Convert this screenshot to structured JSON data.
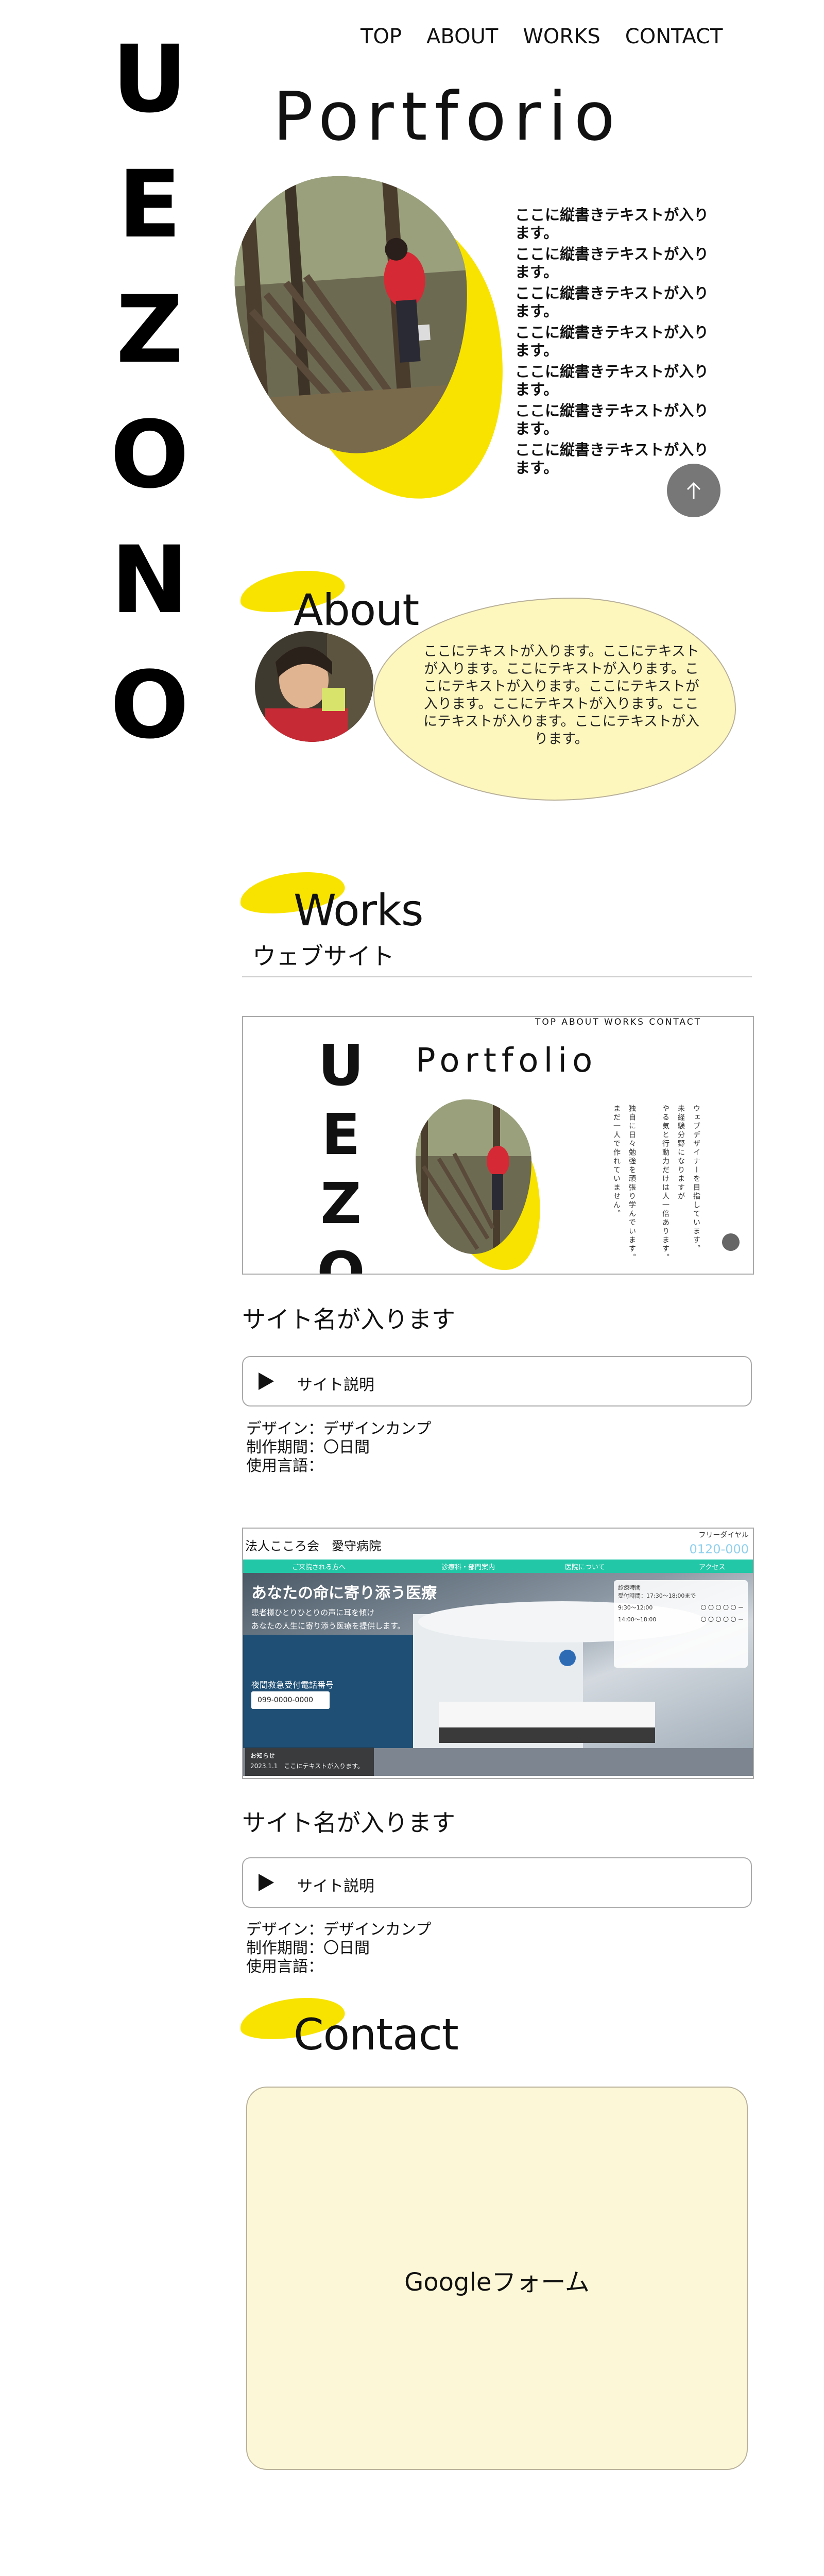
{
  "nav": {
    "items": [
      "TOP",
      "ABOUT",
      "WORKS",
      "CONTACT"
    ]
  },
  "brand": "UEZONO",
  "hero": {
    "title": "Portforio",
    "vertical_text": [
      "ここに縦書きテキストが入ります。",
      "ここに縦書きテキストが入ります。",
      "ここに縦書きテキストが入ります。",
      "ここに縦書きテキストが入ります。",
      "ここに縦書きテキストが入ります。",
      "ここに縦書きテキストが入ります。",
      "ここに縦書きテキストが入ります。"
    ]
  },
  "about": {
    "title": "About",
    "text": "ここにテキストが入ります。ここにテキストが入ります。ここにテキストが入ります。ここにテキストが入ります。ここにテキストが入ります。ここにテキストが入ります。ここにテキストが入ります。ここにテキストが入ります。"
  },
  "works": {
    "title": "Works",
    "category": "ウェブサイト",
    "items": [
      {
        "site_name": "サイト名が入ります",
        "desc_button": "サイト説明",
        "meta": [
          "デザイン：デザインカンプ",
          "制作期間：〇日間",
          "使用言語："
        ],
        "preview": {
          "nav": "TOP  ABOUT  WORKS  CONTACT",
          "brand": "UEZONO",
          "title": "Portfolio",
          "vertical_columns": [
            "ウェブデザイナーを目指しています。",
            "未経験分野になりますが",
            "やる気と行動力だけは人一倍あります。",
            "独自に日々勉強を頑張り学んでいます。",
            "まだ一人で作れていません。"
          ]
        }
      },
      {
        "site_name": "サイト名が入ります",
        "desc_button": "サイト説明",
        "meta": [
          "デザイン：デザインカンプ",
          "制作期間：〇日間",
          "使用言語："
        ],
        "preview": {
          "hospital_name": "法人こころ会　愛守病院",
          "free_dial": "フリーダイヤル",
          "phone": "0120-000",
          "menu": [
            "ご来院される方へ",
            "診療科・部門案内",
            "医院について",
            "アクセス"
          ],
          "headline": "あなたの命に寄り添う医療",
          "sub": [
            "患者様ひとりひとりの声に耳を傾け",
            "あなたの人生に寄り添う医療を提供します。"
          ],
          "tel_label": "夜間救急受付電話番号",
          "tel": "099-0000-0000",
          "news_title": "お知らせ",
          "news_line": "2023.1.1　ここにテキストが入ります。",
          "schedule_title": "診療時間",
          "schedule_hours": "受付時間：17:30〜18:00まで",
          "schedule_rows": [
            {
              "time": "9:30〜12:00",
              "marks": "〇 〇 〇 〇 〇 ー"
            },
            {
              "time": "14:00〜18:00",
              "marks": "〇 〇 〇 〇 〇 ー"
            }
          ]
        }
      }
    ]
  },
  "contact": {
    "title": "Contact",
    "form_label": "Googleフォーム"
  },
  "colors": {
    "accent_yellow": "#f8e300",
    "pale_yellow": "#fdf6bd",
    "teal": "#22c7a7"
  }
}
